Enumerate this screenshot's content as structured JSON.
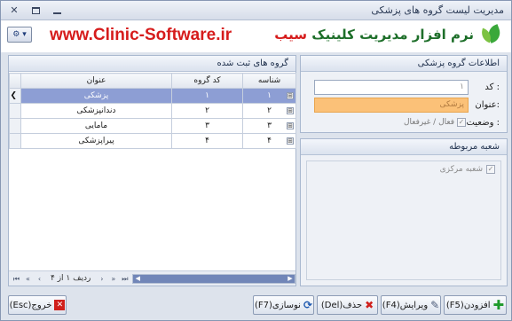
{
  "window": {
    "title": "مدیریت لیست گروه های پزشکی"
  },
  "header": {
    "nav_label": "⚙ ▾",
    "site_url": "www.Clinic-Software.ir",
    "brand_main": "نرم افزار مدیریت کلینیک",
    "brand_accent": "سیب"
  },
  "info_panel": {
    "title": "اطلاعات گروه پزشکی",
    "code_label": "کد :",
    "code_value": "۱",
    "title_label": "عنوان:",
    "title_value": "پزشکی",
    "status_label": "وضعیت :",
    "status_text": "فعال / غیرفعال",
    "status_checked": true
  },
  "branch_panel": {
    "title": "شعبه مربوطه",
    "item_label": "شعبه مرکزی",
    "item_checked": true
  },
  "groups_panel": {
    "title": "گروه های ثبت شده",
    "columns": [
      "شناسه",
      "کد گروه",
      "عنوان"
    ],
    "rows": [
      {
        "id": "۱",
        "code": "۱",
        "name": "پزشکی"
      },
      {
        "id": "۲",
        "code": "۲",
        "name": "دندانپزشکی"
      },
      {
        "id": "۳",
        "code": "۳",
        "name": "مامایی"
      },
      {
        "id": "۴",
        "code": "۴",
        "name": "پیراپزشکی"
      }
    ],
    "selected_row_index": 0,
    "pager_text": "ردیف ۱ از ۴"
  },
  "buttons": {
    "add": "افزودن(F5)",
    "edit": "ویرایش(F4)",
    "delete": "حذف(Del)",
    "refresh": "نوسازی(F7)",
    "exit": "خروج(Esc)"
  },
  "colors": {
    "selected_row": "#8d9ed4",
    "title_field": "#fbc178",
    "url": "#d61c1c",
    "brand": "#1e6f2a"
  }
}
